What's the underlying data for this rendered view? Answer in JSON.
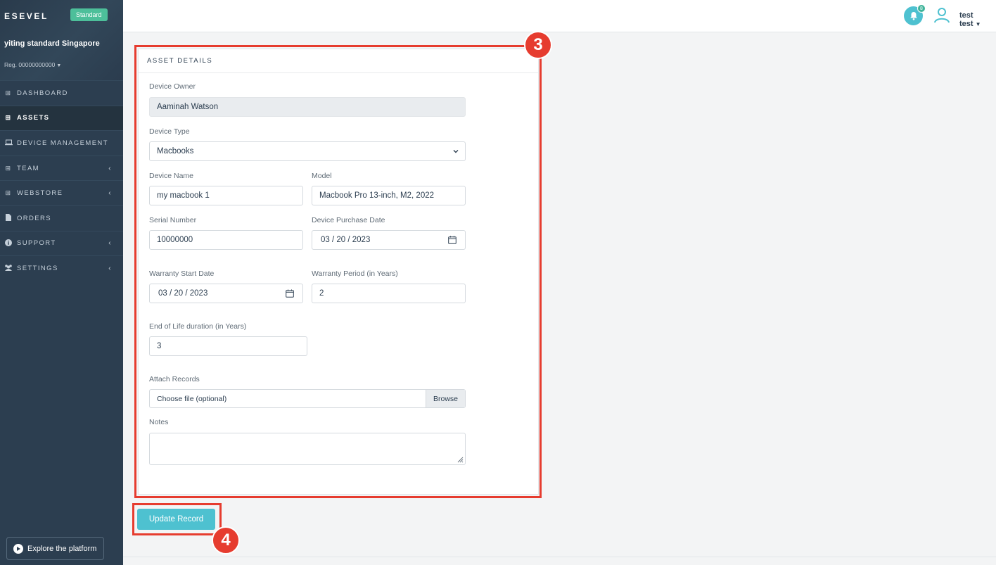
{
  "sidebar": {
    "brand": "ESEVEL",
    "plan_badge": "Standard",
    "org_name": "yiting standard Singapore",
    "org_reg": "Reg. 00000000000",
    "items": [
      {
        "label": "DASHBOARD",
        "icon": "grid-icon"
      },
      {
        "label": "ASSETS",
        "icon": "grid-icon",
        "active": true
      },
      {
        "label": "DEVICE MANAGEMENT",
        "icon": "laptop-icon"
      },
      {
        "label": "TEAM",
        "icon": "grid-icon",
        "chevron": true
      },
      {
        "label": "WEBSTORE",
        "icon": "grid-icon",
        "chevron": true
      },
      {
        "label": "ORDERS",
        "icon": "document-icon"
      },
      {
        "label": "SUPPORT",
        "icon": "info-icon",
        "chevron": true
      },
      {
        "label": "SETTINGS",
        "icon": "users-icon",
        "chevron": true
      }
    ],
    "explore_label": "Explore the platform"
  },
  "topbar": {
    "notification_count": "8",
    "user_name": "test test"
  },
  "form": {
    "title": "ASSET DETAILS",
    "device_owner": {
      "label": "Device Owner",
      "value": "Aaminah Watson"
    },
    "device_type": {
      "label": "Device Type",
      "value": "Macbooks"
    },
    "device_name": {
      "label": "Device Name",
      "value": "my macbook 1"
    },
    "model": {
      "label": "Model",
      "value": "Macbook Pro 13-inch, M2, 2022"
    },
    "serial_number": {
      "label": "Serial Number",
      "value": "10000000"
    },
    "purchase_date": {
      "label": "Device Purchase Date",
      "value": "03 / 20 / 2023"
    },
    "warranty_start": {
      "label": "Warranty Start Date",
      "value": "03 / 20 / 2023"
    },
    "warranty_period": {
      "label": "Warranty Period (in Years)",
      "value": "2"
    },
    "end_of_life": {
      "label": "End of Life duration (in Years)",
      "value": "3"
    },
    "attach_records": {
      "label": "Attach Records",
      "placeholder": "Choose file (optional)",
      "browse_label": "Browse"
    },
    "notes": {
      "label": "Notes",
      "value": ""
    },
    "submit_label": "Update Record"
  },
  "annotations": {
    "step_form": "3",
    "step_submit": "4",
    "color": "#e63c2f"
  },
  "colors": {
    "sidebar_bg": "#2c3e50",
    "accent": "#4ec1d0",
    "badge_green": "#4dbf9a"
  }
}
